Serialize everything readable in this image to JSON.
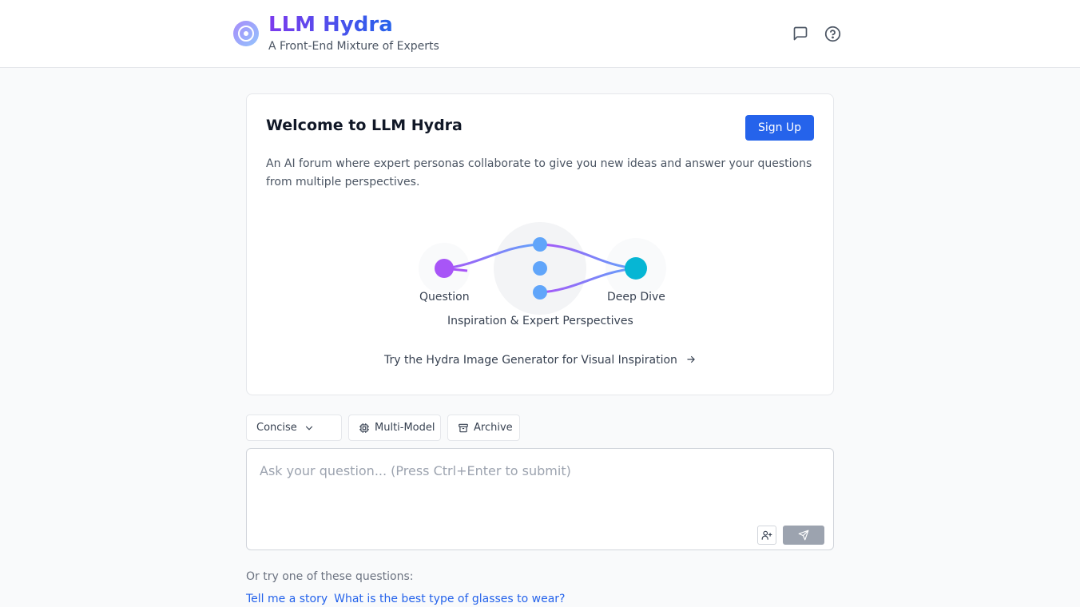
{
  "header": {
    "title": "LLM Hydra",
    "subtitle": "A Front-End Mixture of Experts",
    "logo_icon": "hydra-logo-icon",
    "icons": [
      "message-square-icon",
      "help-circle-icon"
    ]
  },
  "welcome": {
    "title": "Welcome to LLM Hydra",
    "signup_label": "Sign Up",
    "description": "An AI forum where expert personas collaborate to give you new ideas and answer your questions from multiple perspectives.",
    "flow": {
      "question_label": "Question",
      "experts_label": "Inspiration & Expert Perspectives",
      "deep_dive_label": "Deep Dive"
    },
    "image_generator_link": "Try the Hydra Image Generator for Visual Inspiration",
    "link_icon": "arrow-right-icon"
  },
  "toolbar": {
    "mode_selected": "Concise",
    "multi_model_label": "Multi-Model",
    "archive_label": "Archive"
  },
  "input": {
    "placeholder": "Ask your question... (Press Ctrl+Enter to submit)",
    "value": ""
  },
  "suggestions": {
    "heading": "Or try one of these questions:",
    "items": [
      "Tell me a story",
      "What is the best type of glasses to wear?"
    ]
  },
  "colors": {
    "brand_purple": "#7c3aed",
    "brand_blue": "#2563eb",
    "question_node": "#a855f7",
    "expert_node": "#60a5fa",
    "deep_dive_node": "#06b6d4",
    "send_disabled": "#9ca3af"
  }
}
